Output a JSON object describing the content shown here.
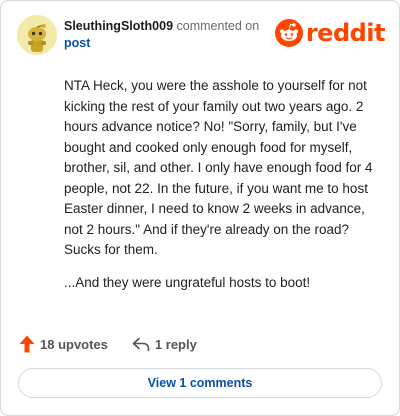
{
  "comment": {
    "username": "SleuthingSloth009",
    "action_text": "commented on",
    "post_link": "post",
    "avatar_icon": "snoo-avatar",
    "body": [
      "NTA Heck, you were the asshole to yourself for not kicking the rest of your family out two years ago. 2 hours advance notice? No! \"Sorry, family, but I've bought and cooked only enough food for myself, brother, sil, and other. I only have enough food for 4 people, not 22. In the future, if you want me to host Easter dinner, I need to know 2 weeks in advance, not 2 hours.\" And if they're already on the road? Sucks for them.",
      "...And they were ungrateful hosts to boot!"
    ]
  },
  "logo": {
    "text": "reddit",
    "icon": "reddit-alien-icon",
    "color": "#ff4500"
  },
  "actions": {
    "upvotes_label": "18 upvotes",
    "upvote_icon": "upvote-arrow-icon",
    "upvote_color": "#ff4500",
    "reply_label": "1 reply",
    "reply_icon": "reply-arrow-icon"
  },
  "footer": {
    "view_comments_label": "View 1 comments",
    "link_color": "#0b4fad"
  }
}
